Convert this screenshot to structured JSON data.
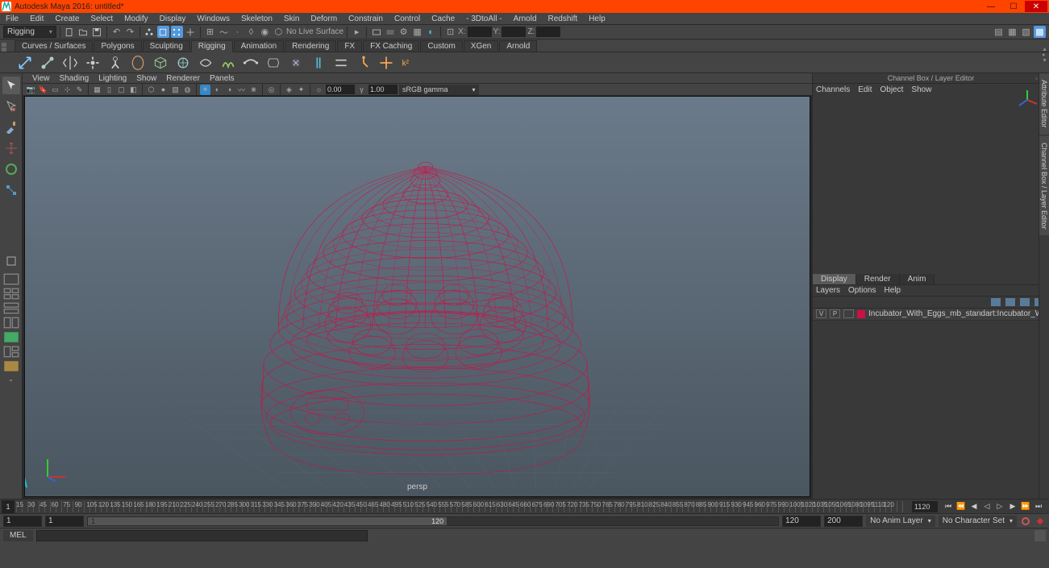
{
  "title": "Autodesk Maya 2016: untitled*",
  "menus": [
    "File",
    "Edit",
    "Create",
    "Select",
    "Modify",
    "Display",
    "Windows",
    "Skeleton",
    "Skin",
    "Deform",
    "Constrain",
    "Control",
    "Cache",
    "- 3DtoAll -",
    "Arnold",
    "Redshift",
    "Help"
  ],
  "workspace_selector": "Rigging",
  "coord_labels": {
    "x": "X:",
    "y": "Y:",
    "z": "Z:"
  },
  "no_live_surface": "No Live Surface",
  "shelf_tabs": [
    "Curves / Surfaces",
    "Polygons",
    "Sculpting",
    "Rigging",
    "Animation",
    "Rendering",
    "FX",
    "FX Caching",
    "Custom",
    "XGen",
    "Arnold"
  ],
  "shelf_active": "Rigging",
  "viewport_menus": [
    "View",
    "Shading",
    "Lighting",
    "Show",
    "Renderer",
    "Panels"
  ],
  "viewport_vals": {
    "a": "0.00",
    "b": "1.00"
  },
  "viewport_gamma": "sRGB gamma",
  "persp_label": "persp",
  "right_panel": {
    "title": "Channel Box / Layer Editor",
    "menu": [
      "Channels",
      "Edit",
      "Object",
      "Show"
    ],
    "tabs": [
      "Display",
      "Render",
      "Anim"
    ],
    "active_tab": "Display",
    "menu2": [
      "Layers",
      "Options",
      "Help"
    ],
    "layer": {
      "v": "V",
      "p": "P",
      "name": "Incubator_With_Eggs_mb_standart:Incubator_With_Eggs"
    }
  },
  "vert_tabs": [
    "Attribute Editor",
    "Channel Box / Layer Editor"
  ],
  "timeline": {
    "current": "1",
    "ticks": [
      "15",
      "30",
      "45",
      "60",
      "75",
      "90",
      "105",
      "120",
      "135",
      "150",
      "165",
      "180",
      "195",
      "210",
      "225",
      "240",
      "255",
      "270",
      "285",
      "300",
      "315",
      "330",
      "345",
      "360",
      "375",
      "390",
      "405",
      "420",
      "435",
      "450",
      "465",
      "480",
      "495",
      "510",
      "525",
      "540",
      "555",
      "570",
      "585",
      "600",
      "615",
      "630",
      "645",
      "660",
      "675",
      "690",
      "705",
      "720",
      "735",
      "750",
      "765",
      "780",
      "795",
      "810",
      "825",
      "840",
      "855",
      "870",
      "885",
      "900",
      "915",
      "930",
      "945",
      "960",
      "975",
      "990",
      "1005",
      "1020",
      "1035",
      "1050",
      "1065",
      "1080",
      "1095",
      "1110",
      "120"
    ],
    "end": "1120"
  },
  "range": {
    "start": "1",
    "play_start": "1",
    "play_end": "120",
    "end": "120",
    "end2": "200",
    "anim_layer": "No Anim Layer",
    "char_set": "No Character Set"
  },
  "slider_left": "1",
  "slider_right": "120",
  "mel_label": "MEL"
}
